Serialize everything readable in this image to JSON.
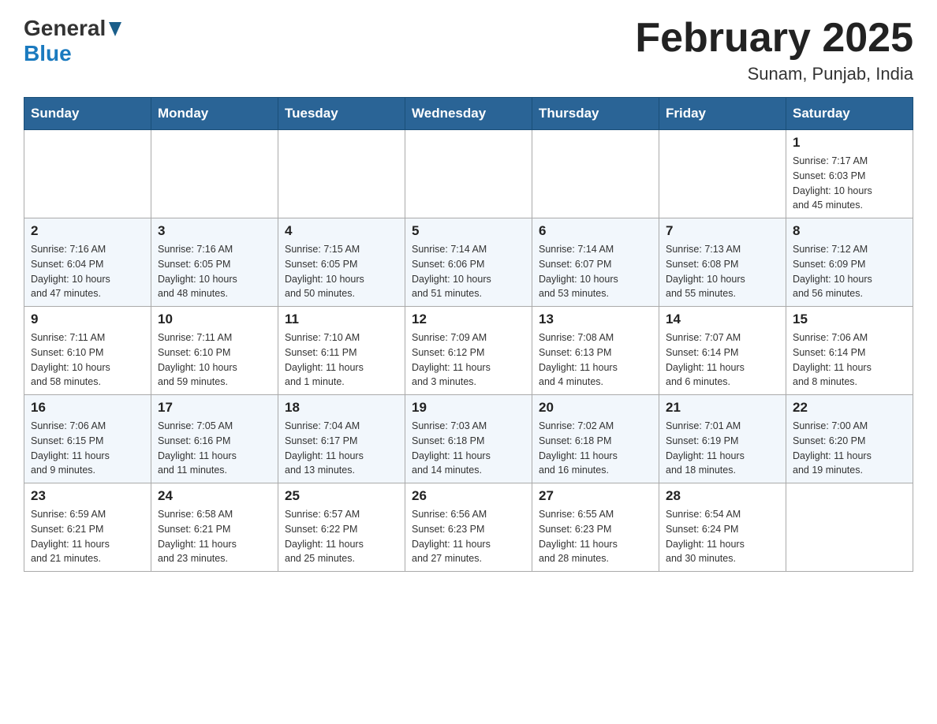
{
  "header": {
    "logo_general": "General",
    "logo_blue": "Blue",
    "month_title": "February 2025",
    "location": "Sunam, Punjab, India"
  },
  "weekdays": [
    "Sunday",
    "Monday",
    "Tuesday",
    "Wednesday",
    "Thursday",
    "Friday",
    "Saturday"
  ],
  "weeks": [
    [
      {
        "day": "",
        "info": ""
      },
      {
        "day": "",
        "info": ""
      },
      {
        "day": "",
        "info": ""
      },
      {
        "day": "",
        "info": ""
      },
      {
        "day": "",
        "info": ""
      },
      {
        "day": "",
        "info": ""
      },
      {
        "day": "1",
        "info": "Sunrise: 7:17 AM\nSunset: 6:03 PM\nDaylight: 10 hours\nand 45 minutes."
      }
    ],
    [
      {
        "day": "2",
        "info": "Sunrise: 7:16 AM\nSunset: 6:04 PM\nDaylight: 10 hours\nand 47 minutes."
      },
      {
        "day": "3",
        "info": "Sunrise: 7:16 AM\nSunset: 6:05 PM\nDaylight: 10 hours\nand 48 minutes."
      },
      {
        "day": "4",
        "info": "Sunrise: 7:15 AM\nSunset: 6:05 PM\nDaylight: 10 hours\nand 50 minutes."
      },
      {
        "day": "5",
        "info": "Sunrise: 7:14 AM\nSunset: 6:06 PM\nDaylight: 10 hours\nand 51 minutes."
      },
      {
        "day": "6",
        "info": "Sunrise: 7:14 AM\nSunset: 6:07 PM\nDaylight: 10 hours\nand 53 minutes."
      },
      {
        "day": "7",
        "info": "Sunrise: 7:13 AM\nSunset: 6:08 PM\nDaylight: 10 hours\nand 55 minutes."
      },
      {
        "day": "8",
        "info": "Sunrise: 7:12 AM\nSunset: 6:09 PM\nDaylight: 10 hours\nand 56 minutes."
      }
    ],
    [
      {
        "day": "9",
        "info": "Sunrise: 7:11 AM\nSunset: 6:10 PM\nDaylight: 10 hours\nand 58 minutes."
      },
      {
        "day": "10",
        "info": "Sunrise: 7:11 AM\nSunset: 6:10 PM\nDaylight: 10 hours\nand 59 minutes."
      },
      {
        "day": "11",
        "info": "Sunrise: 7:10 AM\nSunset: 6:11 PM\nDaylight: 11 hours\nand 1 minute."
      },
      {
        "day": "12",
        "info": "Sunrise: 7:09 AM\nSunset: 6:12 PM\nDaylight: 11 hours\nand 3 minutes."
      },
      {
        "day": "13",
        "info": "Sunrise: 7:08 AM\nSunset: 6:13 PM\nDaylight: 11 hours\nand 4 minutes."
      },
      {
        "day": "14",
        "info": "Sunrise: 7:07 AM\nSunset: 6:14 PM\nDaylight: 11 hours\nand 6 minutes."
      },
      {
        "day": "15",
        "info": "Sunrise: 7:06 AM\nSunset: 6:14 PM\nDaylight: 11 hours\nand 8 minutes."
      }
    ],
    [
      {
        "day": "16",
        "info": "Sunrise: 7:06 AM\nSunset: 6:15 PM\nDaylight: 11 hours\nand 9 minutes."
      },
      {
        "day": "17",
        "info": "Sunrise: 7:05 AM\nSunset: 6:16 PM\nDaylight: 11 hours\nand 11 minutes."
      },
      {
        "day": "18",
        "info": "Sunrise: 7:04 AM\nSunset: 6:17 PM\nDaylight: 11 hours\nand 13 minutes."
      },
      {
        "day": "19",
        "info": "Sunrise: 7:03 AM\nSunset: 6:18 PM\nDaylight: 11 hours\nand 14 minutes."
      },
      {
        "day": "20",
        "info": "Sunrise: 7:02 AM\nSunset: 6:18 PM\nDaylight: 11 hours\nand 16 minutes."
      },
      {
        "day": "21",
        "info": "Sunrise: 7:01 AM\nSunset: 6:19 PM\nDaylight: 11 hours\nand 18 minutes."
      },
      {
        "day": "22",
        "info": "Sunrise: 7:00 AM\nSunset: 6:20 PM\nDaylight: 11 hours\nand 19 minutes."
      }
    ],
    [
      {
        "day": "23",
        "info": "Sunrise: 6:59 AM\nSunset: 6:21 PM\nDaylight: 11 hours\nand 21 minutes."
      },
      {
        "day": "24",
        "info": "Sunrise: 6:58 AM\nSunset: 6:21 PM\nDaylight: 11 hours\nand 23 minutes."
      },
      {
        "day": "25",
        "info": "Sunrise: 6:57 AM\nSunset: 6:22 PM\nDaylight: 11 hours\nand 25 minutes."
      },
      {
        "day": "26",
        "info": "Sunrise: 6:56 AM\nSunset: 6:23 PM\nDaylight: 11 hours\nand 27 minutes."
      },
      {
        "day": "27",
        "info": "Sunrise: 6:55 AM\nSunset: 6:23 PM\nDaylight: 11 hours\nand 28 minutes."
      },
      {
        "day": "28",
        "info": "Sunrise: 6:54 AM\nSunset: 6:24 PM\nDaylight: 11 hours\nand 30 minutes."
      },
      {
        "day": "",
        "info": ""
      }
    ]
  ]
}
